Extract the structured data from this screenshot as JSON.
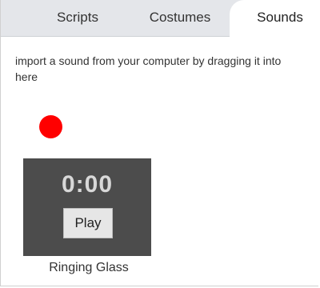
{
  "tabs": [
    {
      "label": "Scripts",
      "active": false
    },
    {
      "label": "Costumes",
      "active": false
    },
    {
      "label": "Sounds",
      "active": true
    }
  ],
  "hint_text": "import a sound from your computer by dragging it into here",
  "record_button": {
    "icon": "record-dot-icon",
    "color": "#ff0000"
  },
  "sound": {
    "duration": "0:00",
    "play_label": "Play",
    "name": "Ringing Glass"
  },
  "colors": {
    "tabbar_bg": "#e4e6ea",
    "tile_bg": "#4c4c4c",
    "record": "#ff0000"
  }
}
